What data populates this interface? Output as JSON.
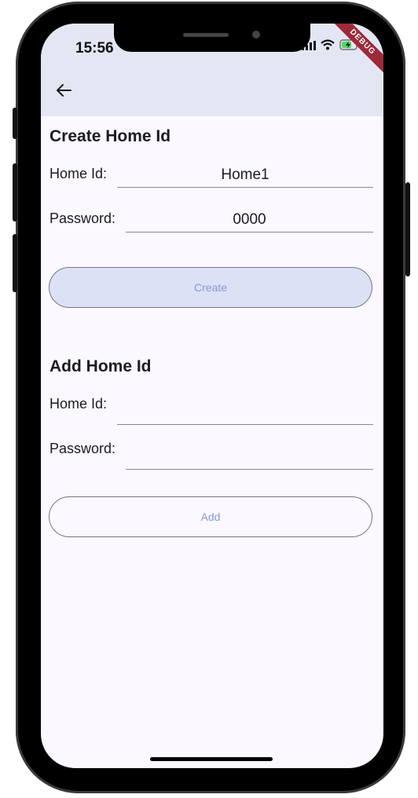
{
  "status_bar": {
    "time": "15:56",
    "debug_label": "DEBUG"
  },
  "colors": {
    "app_bar": "#e3e7f4",
    "background": "#fbf8ff",
    "button_fill_create": "#dde1f5",
    "button_text": "#8898d4",
    "debug_ribbon": "#9c2a3a"
  },
  "icons": {
    "back": "arrow-left-icon",
    "signal": "cellular-signal-icon",
    "wifi": "wifi-icon",
    "battery": "battery-charging-icon"
  },
  "create_section": {
    "title": "Create Home Id",
    "home_id_label": "Home Id:",
    "home_id_value": "Home1",
    "password_label": "Password:",
    "password_value": "0000",
    "button_label": "Create"
  },
  "add_section": {
    "title": "Add Home Id",
    "home_id_label": "Home Id:",
    "home_id_value": "",
    "password_label": "Password:",
    "password_value": "",
    "button_label": "Add"
  }
}
